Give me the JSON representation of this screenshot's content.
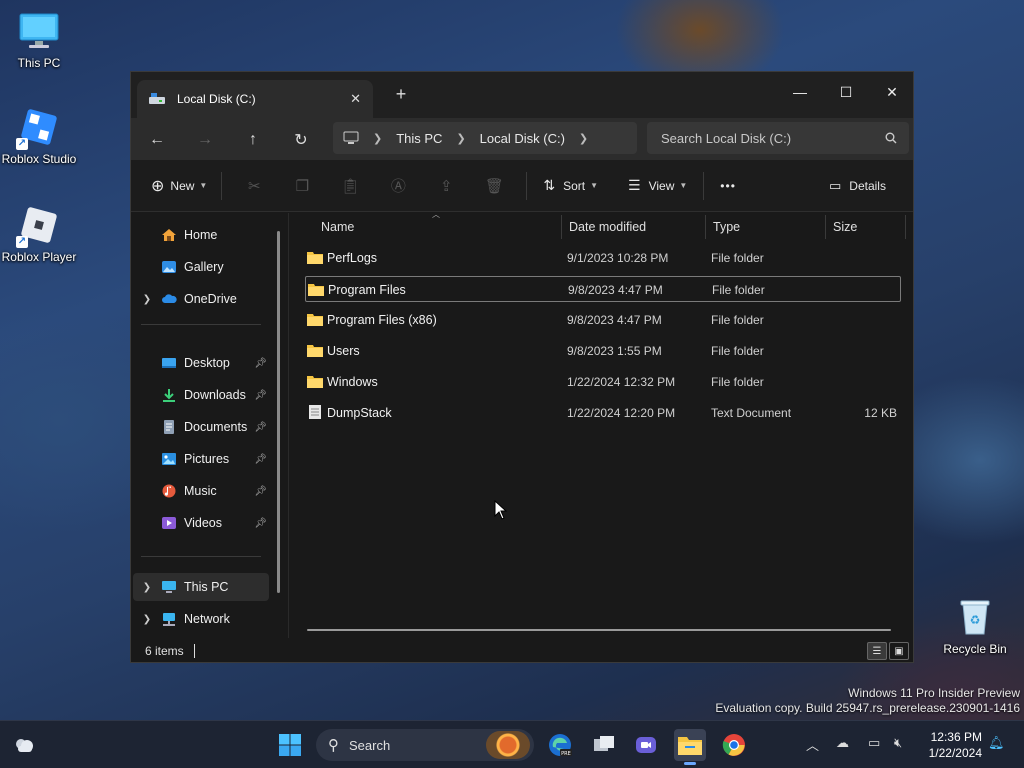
{
  "desktop": {
    "icons": [
      {
        "label": "This PC"
      },
      {
        "label": "Roblox Studio"
      },
      {
        "label": "Roblox Player"
      },
      {
        "label": "Recycle Bin"
      }
    ],
    "watermark": {
      "line1": "Windows 11 Pro Insider Preview",
      "line2": "Evaluation copy. Build 25947.rs_prerelease.230901-1416"
    }
  },
  "window": {
    "tab_title": "Local Disk (C:)",
    "tab_close": "✕",
    "new_tab": "+",
    "controls": {
      "minimize": "—",
      "maximize": "☐",
      "close": "✕"
    },
    "breadcrumb": [
      "This PC",
      "Local Disk (C:)"
    ],
    "search_placeholder": "Search Local Disk (C:)",
    "command_bar": {
      "new_label": "New",
      "sort_label": "Sort",
      "view_label": "View",
      "more_label": "•••",
      "details_label": "Details"
    },
    "nav": {
      "home": "Home",
      "gallery": "Gallery",
      "onedrive": "OneDrive",
      "desktop": "Desktop",
      "downloads": "Downloads",
      "documents": "Documents",
      "pictures": "Pictures",
      "music": "Music",
      "videos": "Videos",
      "thispc": "This PC",
      "network": "Network"
    },
    "columns": {
      "name": "Name",
      "date": "Date modified",
      "type": "Type",
      "size": "Size"
    },
    "files": [
      {
        "name": "PerfLogs",
        "date": "9/1/2023 10:28 PM",
        "type": "File folder",
        "size": "",
        "kind": "folder"
      },
      {
        "name": "Program Files",
        "date": "9/8/2023 4:47 PM",
        "type": "File folder",
        "size": "",
        "kind": "folder"
      },
      {
        "name": "Program Files (x86)",
        "date": "9/8/2023 4:47 PM",
        "type": "File folder",
        "size": "",
        "kind": "folder"
      },
      {
        "name": "Users",
        "date": "9/8/2023 1:55 PM",
        "type": "File folder",
        "size": "",
        "kind": "folder"
      },
      {
        "name": "Windows",
        "date": "1/22/2024 12:32 PM",
        "type": "File folder",
        "size": "",
        "kind": "folder"
      },
      {
        "name": "DumpStack",
        "date": "1/22/2024 12:20 PM",
        "type": "Text Document",
        "size": "12 KB",
        "kind": "text"
      }
    ],
    "status": "6 items"
  },
  "taskbar": {
    "search_label": "Search",
    "clock_time": "12:36 PM",
    "clock_date": "1/22/2024"
  },
  "colors": {
    "folder": "#f5c542",
    "accent": "#4cc2ff",
    "window_bg": "#191919"
  }
}
